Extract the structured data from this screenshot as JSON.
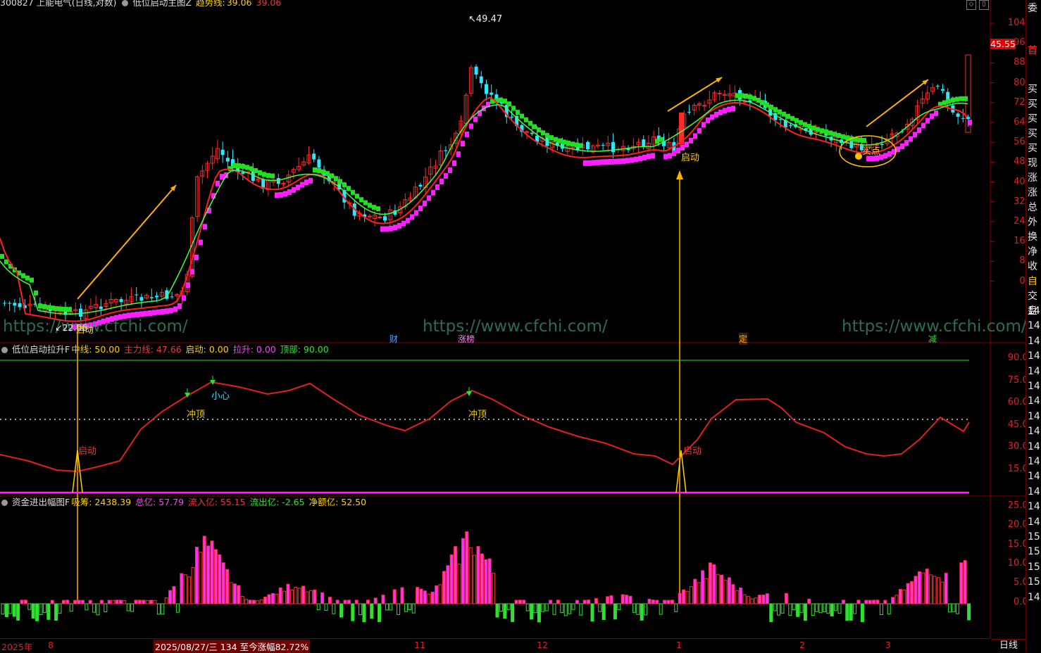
{
  "header1": {
    "stock": "300827 上能电气(日线,对数)",
    "indicator": "低位启动主图Z",
    "trend_label": "趋势线:",
    "trend_val1": "39.06",
    "trend_val2": "39.06"
  },
  "header2": {
    "indicator": "低位启动拉升F",
    "mid": "中线: 50.00",
    "main": "主力线: 47.66",
    "start": "启动: 0.00",
    "pull": "拉升: 0.00",
    "top": "顶部: 90.00"
  },
  "header3": {
    "indicator": "资金进出幅图F",
    "absorb": "吸筹: 2438.39",
    "total": "总亿: 57.79",
    "inflow": "流入亿: 55.15",
    "outflow": "流出亿: -2.65",
    "net": "净额亿: 52.50"
  },
  "price_axis": [
    "104%",
    "96%",
    "88%",
    "80%",
    "72%",
    "64%",
    "56%",
    "48%",
    "40%",
    "32%",
    "24%",
    "16%",
    "8%",
    "0%"
  ],
  "current_price": "45.55",
  "ind_axis": [
    "90.00",
    "75.00",
    "60.00",
    "45.00",
    "30.00",
    "15.00"
  ],
  "fund_axis": [
    "25.00",
    "20.00",
    "15.00",
    "10.00",
    "5.00",
    "0.00"
  ],
  "annotations": {
    "high": "49.47",
    "low": "22.06",
    "start": "启动",
    "buy": "买点",
    "careful": "小心",
    "top_hit": "冲顶"
  },
  "tags": {
    "cai": "财",
    "zhangbang": "涨榜",
    "ding": "定",
    "jian": "减"
  },
  "watermark": "https://www.cfchi.com/",
  "dates": {
    "y2025": "2025年",
    "m8": "8",
    "highlight": "2025/08/27/三 134 至今涨幅82.72%",
    "m11": "11",
    "m12": "12",
    "m1": "1",
    "m2": "2",
    "m3": "3",
    "period": "日线"
  },
  "sidebar": {
    "top": "委",
    "t2": "首",
    "items": [
      "买",
      "买",
      "买",
      "买",
      "买",
      "现",
      "涨",
      "涨",
      "总",
      "外",
      "换",
      "净",
      "收",
      "自",
      "交",
      "盘"
    ],
    "nums": [
      "14",
      "14",
      "14",
      "14",
      "14",
      "14",
      "14",
      "14",
      "14",
      "14",
      "14",
      "14",
      "14",
      "14",
      "14",
      "15",
      "15",
      "15",
      "15",
      "14"
    ]
  },
  "colors": {
    "up": "#ff3030",
    "down": "#30e0ff",
    "magenta": "#ff20ff",
    "green": "#30e030",
    "yellow": "#ffc000",
    "red_line": "#e02020"
  }
}
